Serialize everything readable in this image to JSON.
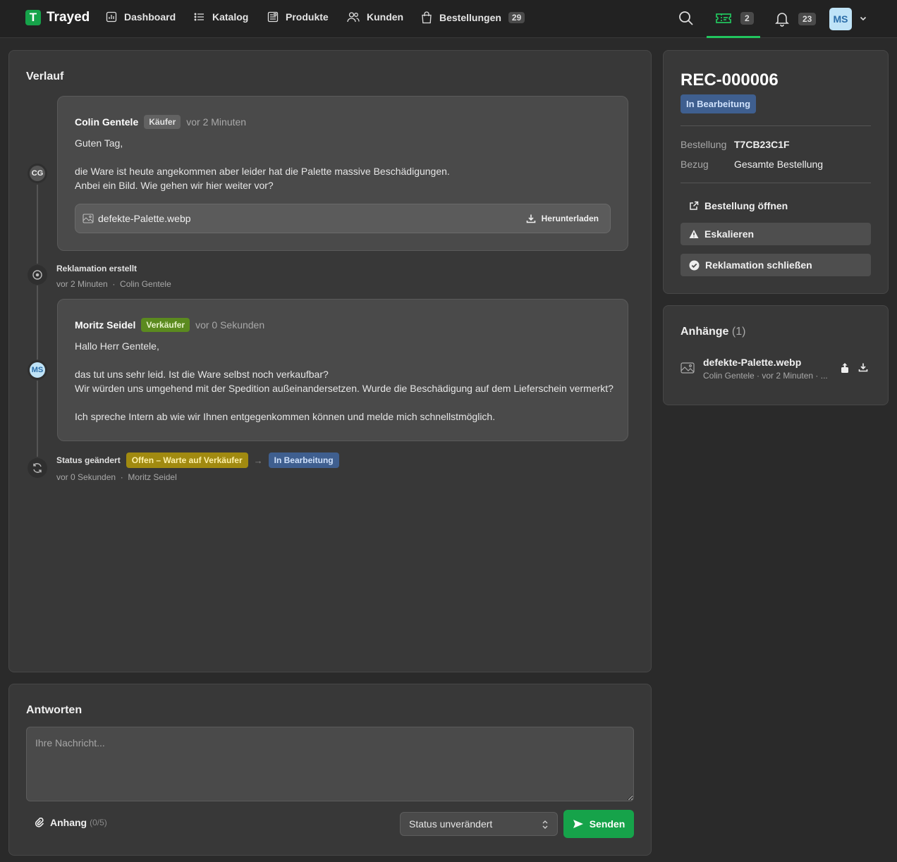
{
  "app": {
    "name": "Trayed",
    "logo_letter": "T"
  },
  "nav": {
    "dashboard": "Dashboard",
    "katalog": "Katalog",
    "produkte": "Produkte",
    "kunden": "Kunden",
    "bestellungen": "Bestellungen",
    "bestellungen_count": "29"
  },
  "toolbar": {
    "tickets_count": "2",
    "notifications_count": "23",
    "user_initials": "MS"
  },
  "timeline": {
    "title": "Verlauf",
    "msg1": {
      "initials": "CG",
      "author": "Colin Gentele",
      "role": "Käufer",
      "time": "vor 2 Minuten",
      "body": "Guten Tag,\n\ndie Ware ist heute angekommen aber leider hat die Palette massive Beschädigungen.\nAnbei ein Bild. Wie gehen wir hier weiter vor?",
      "file_name": "defekte-Palette.webp",
      "download_label": "Herunterladen"
    },
    "event1": {
      "title": "Reklamation erstellt",
      "time": "vor 2 Minuten",
      "sep": "·",
      "actor": "Colin Gentele"
    },
    "msg2": {
      "initials": "MS",
      "author": "Moritz Seidel",
      "role": "Verkäufer",
      "time": "vor 0 Sekunden",
      "body": "Hallo Herr Gentele,\n\ndas tut uns sehr leid. Ist die Ware selbst noch verkaufbar?\nWir würden uns umgehend mit der Spedition außeinandersetzen. Wurde die Beschädigung auf dem Lieferschein vermerkt?\n\nIch spreche Intern ab wie wir Ihnen entgegenkommen können und melde mich schnellstmöglich."
    },
    "event2": {
      "title": "Status geändert",
      "from": "Offen – Warte auf Verkäufer",
      "arrow": "→",
      "to": "In Bearbeitung",
      "time": "vor 0 Sekunden",
      "sep": "·",
      "actor": "Moritz Seidel"
    }
  },
  "reply": {
    "title": "Antworten",
    "placeholder": "Ihre Nachricht...",
    "attach_label": "Anhang",
    "attach_count": "(0/5)",
    "status_select": "Status unverändert",
    "send_label": "Senden"
  },
  "details": {
    "id": "REC-000006",
    "status": "In Bearbeitung",
    "order_label": "Bestellung",
    "order_value": "T7CB23C1F",
    "ref_label": "Bezug",
    "ref_value": "Gesamte Bestellung",
    "open_order": "Bestellung öffnen",
    "escalate": "Eskalieren",
    "close": "Reklamation schließen"
  },
  "attachments": {
    "title": "Anhänge",
    "count": "(1)",
    "file_name": "defekte-Palette.webp",
    "file_meta": "Colin Gentele · vor 2 Minuten · ..."
  },
  "colors": {
    "accent": "#16a34a",
    "status_processing": "#3f5f8f",
    "status_open": "#a18a10",
    "role_seller": "#5b8a1f"
  }
}
